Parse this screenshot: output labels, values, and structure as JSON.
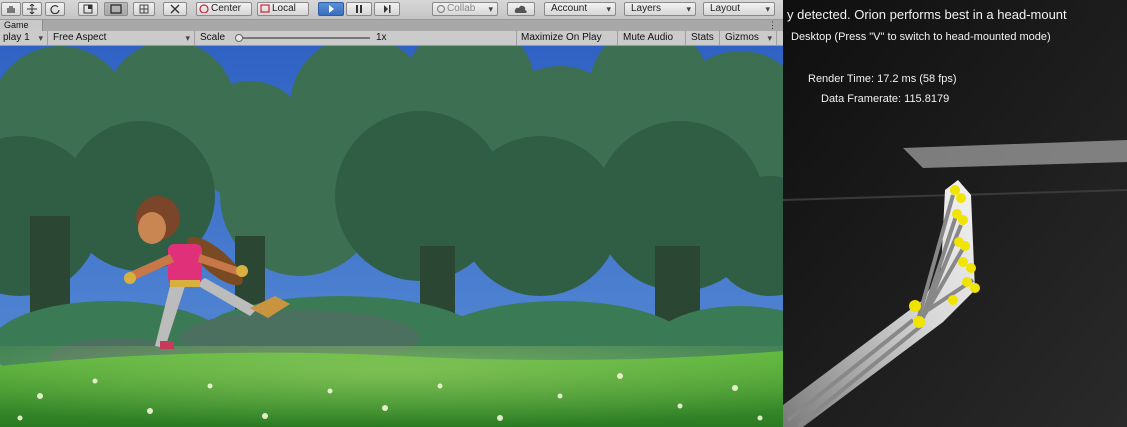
{
  "toolbar": {
    "center_label": "Center",
    "local_label": "Local",
    "collab_label": "Collab",
    "account_label": "Account",
    "layers_label": "Layers",
    "layout_label": "Layout"
  },
  "tabs": {
    "game_tab": "Game"
  },
  "gamebar": {
    "display": "play 1",
    "aspect": "Free Aspect",
    "scale_label": "Scale",
    "scale_value": "1x",
    "maximize": "Maximize On Play",
    "mute": "Mute Audio",
    "stats": "Stats",
    "gizmos": "Gizmos"
  },
  "leap": {
    "warning": "y detected. Orion performs best in a head-mount",
    "mode_hint": "Desktop (Press \"V\" to switch to head-mounted mode)",
    "render_time": "Render Time: 17.2 ms (58 fps)",
    "data_framerate": "Data Framerate: 115.8179"
  },
  "colors": {
    "play_button": "#3a6fc0",
    "fingertip": "#f0e400",
    "sky": "#3a6fc8",
    "grass": "#3c8a2a"
  },
  "icons": [
    "hand-icon",
    "move-icon",
    "rotate-icon",
    "scale-icon",
    "rect-icon",
    "transform-icon",
    "tools-icon",
    "center-icon",
    "local-icon",
    "play-icon",
    "pause-icon",
    "step-icon",
    "collab-icon",
    "cloud-icon"
  ]
}
